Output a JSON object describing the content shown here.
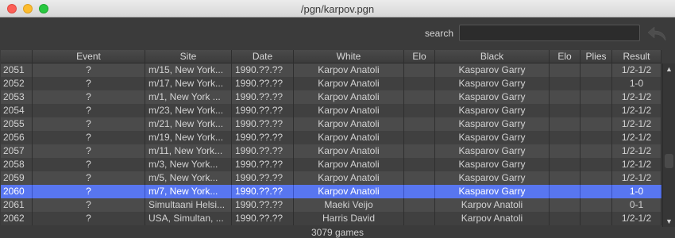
{
  "window": {
    "title": "/pgn/karpov.pgn"
  },
  "toolbar": {
    "search_label": "search",
    "search_value": "",
    "undo_icon": "undo-arrow-icon"
  },
  "table": {
    "columns": [
      "",
      "Event",
      "Site",
      "Date",
      "White",
      "Elo",
      "Black",
      "Elo",
      "Plies",
      "Result"
    ],
    "rows": [
      [
        "2051",
        "?",
        "m/15, New York...",
        "1990.??.??",
        "Karpov Anatoli",
        "",
        "Kasparov Garry",
        "",
        "",
        "1/2-1/2"
      ],
      [
        "2052",
        "?",
        "m/17, New York...",
        "1990.??.??",
        "Karpov Anatoli",
        "",
        "Kasparov Garry",
        "",
        "",
        "1-0"
      ],
      [
        "2053",
        "?",
        "m/1, New York ...",
        "1990.??.??",
        "Karpov Anatoli",
        "",
        "Kasparov Garry",
        "",
        "",
        "1/2-1/2"
      ],
      [
        "2054",
        "?",
        "m/23, New York...",
        "1990.??.??",
        "Karpov Anatoli",
        "",
        "Kasparov Garry",
        "",
        "",
        "1/2-1/2"
      ],
      [
        "2055",
        "?",
        "m/21, New York...",
        "1990.??.??",
        "Karpov Anatoli",
        "",
        "Kasparov Garry",
        "",
        "",
        "1/2-1/2"
      ],
      [
        "2056",
        "?",
        "m/19, New York...",
        "1990.??.??",
        "Karpov Anatoli",
        "",
        "Kasparov Garry",
        "",
        "",
        "1/2-1/2"
      ],
      [
        "2057",
        "?",
        "m/11, New York...",
        "1990.??.??",
        "Karpov Anatoli",
        "",
        "Kasparov Garry",
        "",
        "",
        "1/2-1/2"
      ],
      [
        "2058",
        "?",
        "m/3, New York...",
        "1990.??.??",
        "Karpov Anatoli",
        "",
        "Kasparov Garry",
        "",
        "",
        "1/2-1/2"
      ],
      [
        "2059",
        "?",
        "m/5, New York...",
        "1990.??.??",
        "Karpov Anatoli",
        "",
        "Kasparov Garry",
        "",
        "",
        "1/2-1/2"
      ],
      [
        "2060",
        "?",
        "m/7, New York...",
        "1990.??.??",
        "Karpov Anatoli",
        "",
        "Kasparov Garry",
        "",
        "",
        "1-0"
      ],
      [
        "2061",
        "?",
        "Simultaani Helsi...",
        "1990.??.??",
        "Maeki Veijo",
        "",
        "Karpov Anatoli",
        "",
        "",
        "0-1"
      ],
      [
        "2062",
        "?",
        "USA, Simultan, ...",
        "1990.??.??",
        "Harris David",
        "",
        "Karpov Anatoli",
        "",
        "",
        "1/2-1/2"
      ]
    ],
    "selected_row": "2060"
  },
  "status": {
    "game_count": "3079 games"
  },
  "colors": {
    "selection": "#5876f0",
    "row_odd": "#4b4b4b",
    "row_even": "#404040"
  }
}
